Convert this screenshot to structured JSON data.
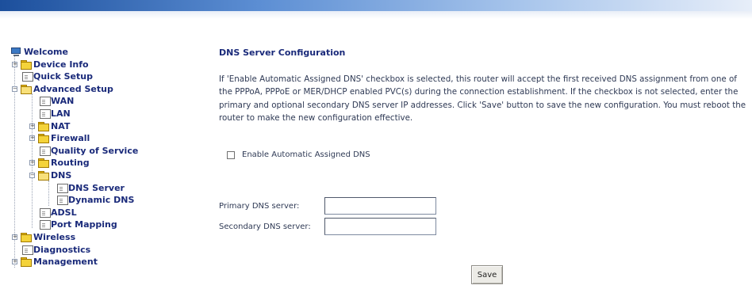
{
  "tree": {
    "items": [
      {
        "label": "Welcome",
        "icon": "computer-icon"
      },
      {
        "label": "Device Info",
        "icon": "folder-icon",
        "expander": "+"
      },
      {
        "label": "Quick Setup",
        "icon": "page-icon"
      },
      {
        "label": "Advanced Setup",
        "icon": "folder-open-icon",
        "expander": "−"
      },
      {
        "label": "WAN",
        "icon": "page-icon"
      },
      {
        "label": "LAN",
        "icon": "page-icon"
      },
      {
        "label": "NAT",
        "icon": "folder-icon",
        "expander": "+"
      },
      {
        "label": "Firewall",
        "icon": "folder-icon",
        "expander": "+"
      },
      {
        "label": "Quality of Service",
        "icon": "page-icon"
      },
      {
        "label": "Routing",
        "icon": "folder-icon",
        "expander": "+"
      },
      {
        "label": "DNS",
        "icon": "folder-open-icon",
        "expander": "−"
      },
      {
        "label": "DNS Server",
        "icon": "page-icon"
      },
      {
        "label": "Dynamic DNS",
        "icon": "page-icon"
      },
      {
        "label": "ADSL",
        "icon": "page-icon"
      },
      {
        "label": "Port Mapping",
        "icon": "page-icon"
      },
      {
        "label": "Wireless",
        "icon": "folder-icon",
        "expander": "+"
      },
      {
        "label": "Diagnostics",
        "icon": "page-icon"
      },
      {
        "label": "Management",
        "icon": "folder-icon",
        "expander": "+"
      }
    ]
  },
  "main": {
    "title": "DNS Server Configuration",
    "description": "If 'Enable Automatic Assigned DNS' checkbox is selected, this router will accept the first received DNS assignment from one of the PPPoA, PPPoE or MER/DHCP enabled PVC(s) during the connection establishment. If the checkbox is not selected, enter the primary and optional secondary DNS server IP addresses. Click 'Save' button to save the new configuration. You must reboot the router to make the new configuration effective.",
    "checkbox_label": "Enable Automatic Assigned DNS",
    "checkbox_checked": false,
    "primary_label": "Primary DNS server:",
    "primary_value": "",
    "secondary_label": "Secondary DNS server:",
    "secondary_value": "",
    "save_label": "Save"
  },
  "colors": {
    "nav_text": "#1a2a7a",
    "body_text": "#2f3a55",
    "banner": "#1c4f9c"
  }
}
